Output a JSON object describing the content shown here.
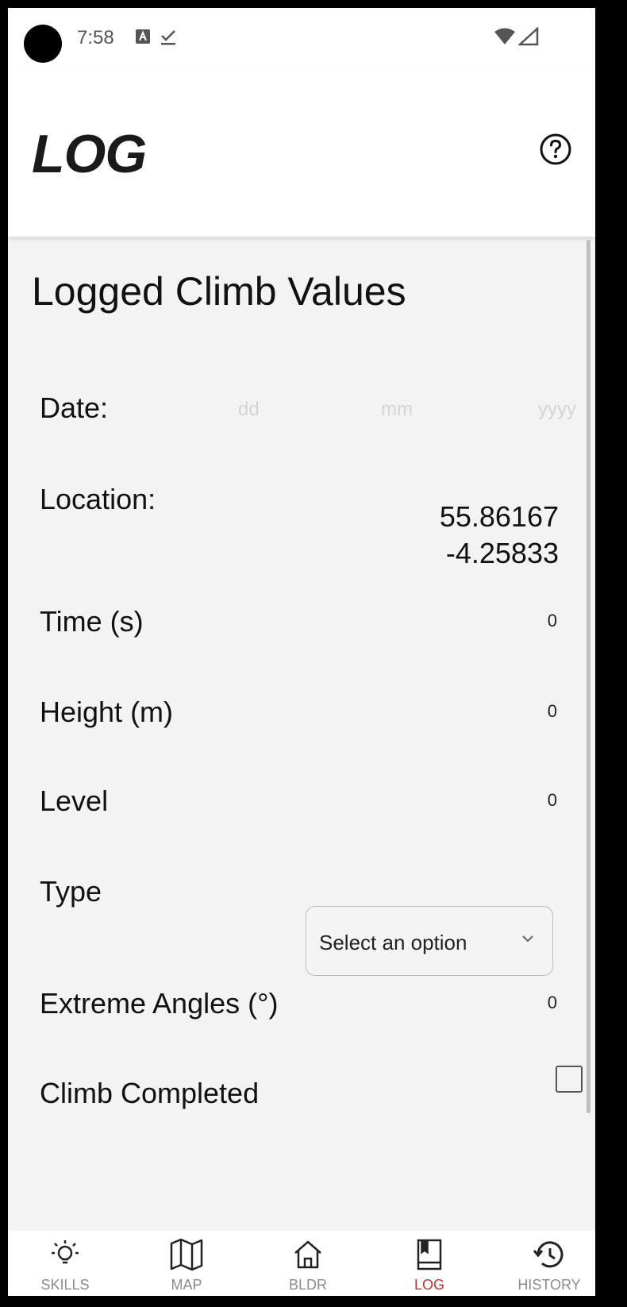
{
  "status_bar": {
    "time": "7:58"
  },
  "app_bar": {
    "title": "LOG",
    "help_icon": "help-circle-icon"
  },
  "section_title": "Logged Climb Values",
  "fields": {
    "date": {
      "label": "Date:",
      "day_placeholder": "dd",
      "month_placeholder": "mm",
      "year_placeholder": "yyyy"
    },
    "location": {
      "label": "Location:",
      "latitude": "55.86167",
      "longitude": "-4.25833"
    },
    "time": {
      "label": "Time (s)",
      "value": "0"
    },
    "height": {
      "label": "Height (m)",
      "value": "0"
    },
    "level": {
      "label": "Level",
      "value": "0"
    },
    "type": {
      "label": "Type",
      "select_value": "Select an option"
    },
    "extreme_angles": {
      "label": "Extreme Angles (°)",
      "value": "0"
    },
    "climb_completed": {
      "label": "Climb Completed",
      "checked": false
    }
  },
  "nav": {
    "skills": {
      "label": "SKILLS",
      "icon": "lightbulb-icon"
    },
    "map": {
      "label": "MAP",
      "icon": "map-icon"
    },
    "bldr": {
      "label": "BLDR",
      "icon": "home-icon"
    },
    "log": {
      "label": "LOG",
      "icon": "book-icon",
      "active": true
    },
    "history": {
      "label": "HISTORY",
      "icon": "history-icon"
    }
  },
  "colors": {
    "active_nav": "#b53a2e",
    "inactive_nav": "#8c8c8c",
    "background": "#f3f3f3"
  }
}
